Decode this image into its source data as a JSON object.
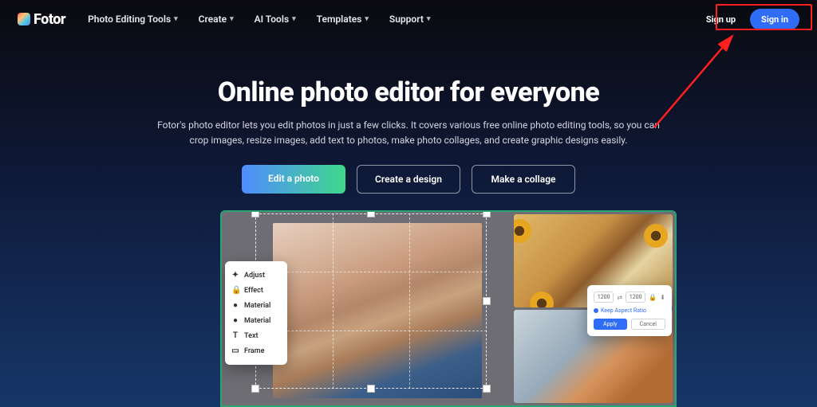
{
  "brand": {
    "name": "Fotor"
  },
  "nav": {
    "items": [
      {
        "label": "Photo Editing Tools"
      },
      {
        "label": "Create"
      },
      {
        "label": "AI Tools"
      },
      {
        "label": "Templates"
      },
      {
        "label": "Support"
      }
    ],
    "signup": "Sign up",
    "signin": "Sign in"
  },
  "hero": {
    "title": "Online photo editor for everyone",
    "subtitle": "Fotor's photo editor lets you edit photos in just a few clicks. It covers various free online photo editing tools, so you can crop images, resize images, add text to photos, make photo collages, and create graphic designs easily.",
    "cta_primary": "Edit a photo",
    "cta_design": "Create a design",
    "cta_collage": "Make a collage"
  },
  "toolpanel": {
    "items": [
      {
        "icon": "✦",
        "label": "Adjust"
      },
      {
        "icon": "🔒",
        "label": "Effect"
      },
      {
        "icon": "●",
        "label": "Material"
      },
      {
        "icon": "●",
        "label": "Material"
      },
      {
        "icon": "T",
        "label": "Text"
      },
      {
        "icon": "▭",
        "label": "Frame"
      }
    ]
  },
  "resize": {
    "w": "1200",
    "h": "1200",
    "keep_ratio": "Keep Aspect Ratio",
    "apply": "Apply",
    "cancel": "Cancel"
  }
}
